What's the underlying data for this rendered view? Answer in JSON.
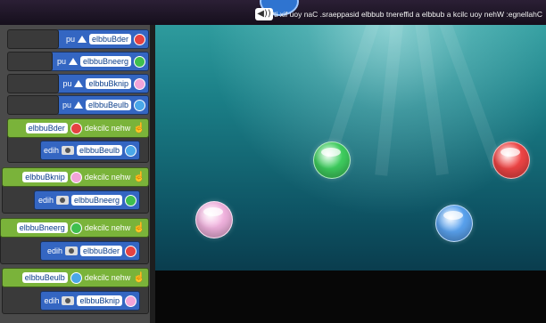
{
  "header": {
    "challenge_text": "Challenge: When you click a bubble a different bubble disappears. Can you fix it?",
    "sound_icon": "speaker-icon"
  },
  "blocks": {
    "move1": {
      "sprite": "redBubble",
      "action": "up"
    },
    "move2": {
      "sprite": "greenBubble",
      "action": "up"
    },
    "move3": {
      "sprite": "pinkBubble",
      "action": "up"
    },
    "move4": {
      "sprite": "blueBubble",
      "action": "up"
    },
    "event1": {
      "label": "when clicked",
      "sprite": "redBubble",
      "hide_sprite": "blueBubble",
      "hide_label": "hide"
    },
    "event2": {
      "label": "when clicked",
      "sprite": "pinkBubble",
      "hide_sprite": "greenBubble",
      "hide_label": "hide"
    },
    "event3": {
      "label": "when clicked",
      "sprite": "greenBubble",
      "hide_sprite": "redBubble",
      "hide_label": "hide"
    },
    "event4": {
      "label": "when clicked",
      "sprite": "blueBubble",
      "hide_sprite": "pinkBubble",
      "hide_label": "hide"
    }
  },
  "stage": {
    "bubbles": [
      {
        "name": "greenBubble",
        "color": "#3fcf5f"
      },
      {
        "name": "redBubble",
        "color": "#f04545"
      },
      {
        "name": "pinkBubble",
        "color": "#f2b3df"
      },
      {
        "name": "blueBubble",
        "color": "#5aa3f0"
      }
    ]
  }
}
